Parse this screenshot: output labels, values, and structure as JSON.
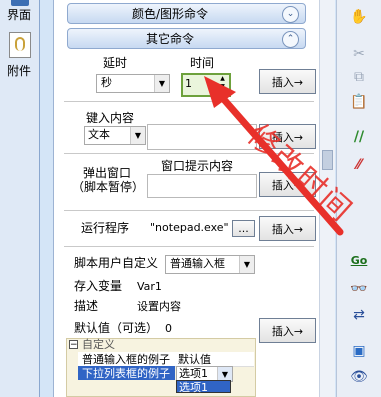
{
  "sidebar": {
    "items": [
      {
        "label": "界面"
      },
      {
        "label": "附件"
      }
    ]
  },
  "sections": {
    "color_graphic": "颜色/图形命令",
    "other_commands": "其它命令"
  },
  "delay": {
    "label_delay": "延时",
    "label_time": "时间",
    "unit_value": "秒",
    "time_value": "1",
    "insert_label": "插入→"
  },
  "keyin": {
    "label": "键入内容",
    "type_value": "文本",
    "insert_label": "插入→"
  },
  "popup": {
    "label_line1": "弹出窗口",
    "label_line2": "（脚本暂停）",
    "content_label": "窗口提示内容",
    "insert_label": "插入→"
  },
  "run": {
    "label": "运行程序",
    "value": "\"notepad.exe\"",
    "browse_label": "...",
    "insert_label": "插入→"
  },
  "custom": {
    "label": "脚本用户自定义",
    "type_value": "普通输入框",
    "var_label": "存入变量",
    "var_value": "Var1",
    "desc_label": "描述",
    "desc_value": "设置内容",
    "default_label": "默认值（可选）",
    "default_value": "0",
    "insert_label": "插入→"
  },
  "preview": {
    "group_title": "自定义",
    "row1_label": "普通输入框的例子",
    "row1_value": "默认值",
    "row2_label": "下拉列表框的例子",
    "row2_value": "选项1",
    "dropdown_item": "选项1"
  },
  "annotation": {
    "text": "修改时间",
    "color": "#e8302a"
  }
}
